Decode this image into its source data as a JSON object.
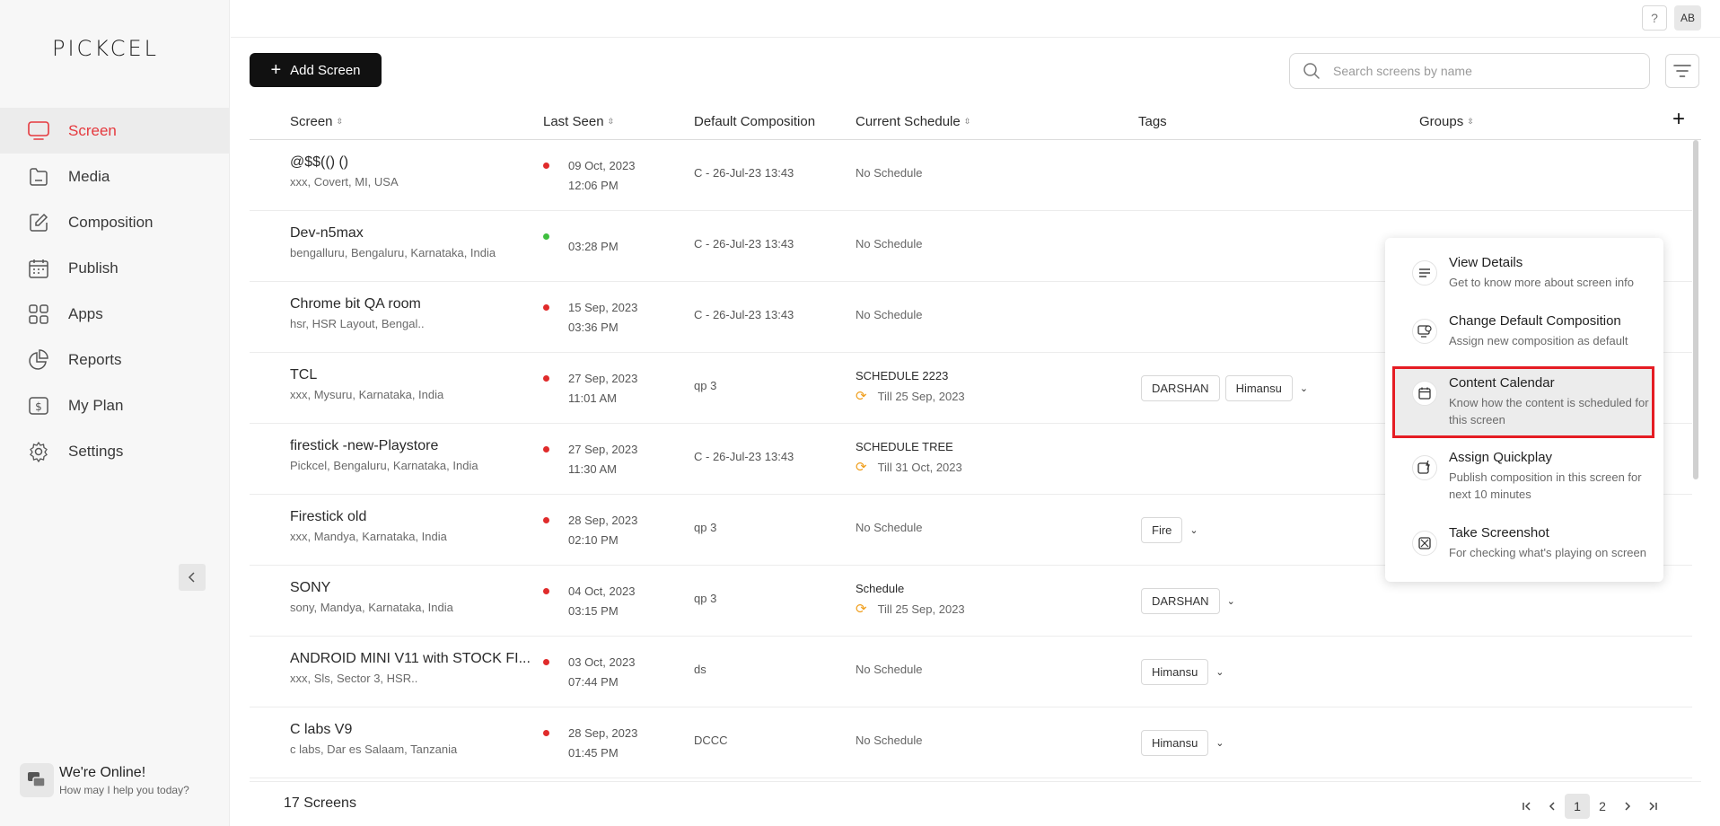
{
  "brand": {
    "logo": "PICKCEL",
    "accent": "#e5393e"
  },
  "sidebar": {
    "items": [
      {
        "label": "Screen",
        "icon": "monitor-icon",
        "active": true
      },
      {
        "label": "Media",
        "icon": "media-folder-icon"
      },
      {
        "label": "Composition",
        "icon": "edit-icon"
      },
      {
        "label": "Publish",
        "icon": "calendar-icon"
      },
      {
        "label": "Apps",
        "icon": "apps-grid-icon"
      },
      {
        "label": "Reports",
        "icon": "pie-chart-icon"
      },
      {
        "label": "My Plan",
        "icon": "plan-icon"
      },
      {
        "label": "Settings",
        "icon": "gear-icon"
      }
    ],
    "chat": {
      "title": "We're Online!",
      "subtitle": "How may I help you today?"
    }
  },
  "topbar": {
    "help": "?",
    "avatar": "AB"
  },
  "toolbar": {
    "add_label": "Add Screen",
    "search_placeholder": "Search screens by name"
  },
  "table": {
    "headers": {
      "screen": "Screen",
      "last_seen": "Last Seen",
      "default_composition": "Default Composition",
      "current_schedule": "Current Schedule",
      "tags": "Tags",
      "groups": "Groups"
    },
    "rows": [
      {
        "name": "@$$(() ()",
        "location": "xxx, Covert, MI, USA",
        "status": "offline",
        "seen_date": "09 Oct, 2023",
        "seen_time": "12:06 PM",
        "composition": "C - 26-Jul-23 13:43",
        "schedule": "No Schedule",
        "schedule_till": "",
        "tags": [],
        "tag_more": false
      },
      {
        "name": "Dev-n5max",
        "location": "bengalluru, Bengaluru, Karnataka, India",
        "status": "online",
        "seen_date": "",
        "seen_time": "03:28 PM",
        "composition": "C - 26-Jul-23 13:43",
        "schedule": "No Schedule",
        "schedule_till": "",
        "tags": [],
        "tag_more": false
      },
      {
        "name": "Chrome bit QA room",
        "location": "hsr, HSR Layout, Bengal..",
        "status": "offline",
        "seen_date": "15 Sep, 2023",
        "seen_time": "03:36 PM",
        "composition": "C - 26-Jul-23 13:43",
        "schedule": "No Schedule",
        "schedule_till": "",
        "tags": [],
        "tag_more": false
      },
      {
        "name": "TCL",
        "location": "xxx, Mysuru, Karnataka, India",
        "status": "offline",
        "seen_date": "27 Sep, 2023",
        "seen_time": "11:01 AM",
        "composition": "qp 3",
        "schedule": "SCHEDULE 2223",
        "schedule_till": "Till 25 Sep, 2023",
        "tags": [
          "DARSHAN",
          "Himansu"
        ],
        "tag_more": true
      },
      {
        "name": "firestick -new-Playstore",
        "location": "Pickcel, Bengaluru, Karnataka, India",
        "status": "offline",
        "seen_date": "27 Sep, 2023",
        "seen_time": "11:30 AM",
        "composition": "C - 26-Jul-23 13:43",
        "schedule": "SCHEDULE TREE",
        "schedule_till": "Till 31 Oct, 2023",
        "tags": [],
        "tag_more": false
      },
      {
        "name": "Firestick old",
        "location": "xxx, Mandya, Karnataka, India",
        "status": "offline",
        "seen_date": "28 Sep, 2023",
        "seen_time": "02:10 PM",
        "composition": "qp 3",
        "schedule": "No Schedule",
        "schedule_till": "",
        "tags": [
          "Fire"
        ],
        "tag_more": true
      },
      {
        "name": "SONY",
        "location": "sony, Mandya, Karnataka, India",
        "status": "offline",
        "seen_date": "04 Oct, 2023",
        "seen_time": "03:15 PM",
        "composition": "qp 3",
        "schedule": "Schedule",
        "schedule_till": "Till 25 Sep, 2023",
        "tags": [
          "DARSHAN"
        ],
        "tag_more": true
      },
      {
        "name": "ANDROID MINI V11 with STOCK FI...",
        "location": "xxx, Sls, Sector 3, HSR..",
        "status": "offline",
        "seen_date": "03 Oct, 2023",
        "seen_time": "07:44 PM",
        "composition": "ds",
        "schedule": "No Schedule",
        "schedule_till": "",
        "tags": [
          "Himansu"
        ],
        "tag_more": true
      },
      {
        "name": "C labs V9",
        "location": "c labs, Dar es Salaam, Tanzania",
        "status": "offline",
        "seen_date": "28 Sep, 2023",
        "seen_time": "01:45 PM",
        "composition": "DCCC",
        "schedule": "No Schedule",
        "schedule_till": "",
        "tags": [
          "Himansu"
        ],
        "tag_more": true
      }
    ]
  },
  "footer": {
    "count": "17 Screens",
    "pages": [
      "1",
      "2"
    ],
    "current_page": "1"
  },
  "context_menu": {
    "items": [
      {
        "title": "View Details",
        "desc": "Get to know more about screen info",
        "icon": "details-lines-icon"
      },
      {
        "title": "Change Default Composition",
        "desc": "Assign new composition as default",
        "icon": "composition-refresh-icon"
      },
      {
        "title": "Content Calendar",
        "desc": "Know how the content is scheduled for this screen",
        "icon": "calendar-icon",
        "highlighted": true
      },
      {
        "title": "Assign Quickplay",
        "desc": "Publish composition in this screen for next 10 minutes",
        "icon": "quickplay-icon"
      },
      {
        "title": "Take Screenshot",
        "desc": "For checking what's playing on screen",
        "icon": "screenshot-icon"
      }
    ]
  },
  "colors": {
    "offline": "#e02b2b",
    "online": "#3fbf3f",
    "highlight_border": "#e51c23",
    "schedule_icon": "#f0a020"
  }
}
